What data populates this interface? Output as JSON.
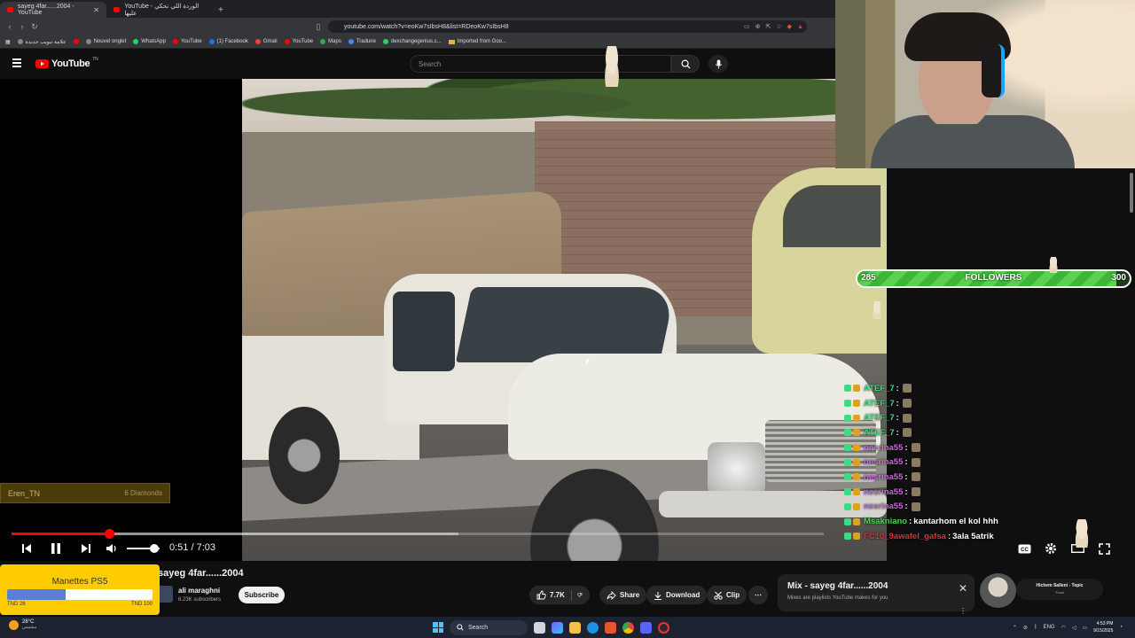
{
  "browser": {
    "tabs": [
      {
        "label": "sayeg 4far......2004 - YouTube",
        "active": true
      },
      {
        "label": "YouTube - الوردة اللي تحكي عليها",
        "active": false
      }
    ],
    "url": "youtube.com/watch?v=eoKw7sIbsH8&list=RDeoKw7sIbsH8",
    "bookmarks": [
      "علامة تبويب جديدة",
      "Nouvel onglet",
      "WhatsApp",
      "YouTube",
      "(1) Facebook",
      "Gmail",
      "YouTube",
      "Maps",
      "Traduire",
      "dexchangegenius.c...",
      "Imported from Goo..."
    ]
  },
  "youtube": {
    "logo_text": "YouTube",
    "logo_region": "TN",
    "search_placeholder": "Search",
    "player": {
      "current_time": "0:51",
      "duration": "7:03",
      "time_separator": "/",
      "played_fraction": 0.12,
      "buffered_fraction": 0.55,
      "volume_fraction": 0.85,
      "accent": "#ff0000"
    },
    "video": {
      "title": "sayeg 4far......2004",
      "channel": "ali maraghni",
      "subscribers": "6.23K subscribers",
      "subscribe_label": "Subscribe",
      "likes": "7.7K",
      "share_label": "Share",
      "download_label": "Download",
      "clip_label": "Clip"
    },
    "mix": {
      "title": "Mix - sayeg 4far......2004",
      "subtitle": "Mixes are playlists YouTube makes for you"
    },
    "related": {
      "name": "Hichem Salleni - Topic",
      "sub": "Trouli"
    }
  },
  "overlay": {
    "followers": {
      "current": "285",
      "label": "FOLLOWERS",
      "goal": "300",
      "fraction": 0.95
    },
    "chat": [
      {
        "user": "ATEF_7",
        "color": "#3ddc84",
        "sep": ":",
        "msg": ""
      },
      {
        "user": "ATEF_7",
        "color": "#3ddc84",
        "sep": ":",
        "msg": ""
      },
      {
        "user": "ATEF_7",
        "color": "#3ddc84",
        "sep": ":",
        "msg": ""
      },
      {
        "user": "ATEF_7",
        "color": "#3ddc84",
        "sep": ":",
        "msg": ""
      },
      {
        "user": "nesrina55",
        "color": "#c86bd6",
        "sep": ":",
        "msg": ""
      },
      {
        "user": "nesrina55",
        "color": "#c86bd6",
        "sep": ":",
        "msg": ""
      },
      {
        "user": "nesrina55",
        "color": "#c86bd6",
        "sep": ":",
        "msg": ""
      },
      {
        "user": "nesrina55",
        "color": "#c86bd6",
        "sep": ":",
        "msg": ""
      },
      {
        "user": "nesrina55",
        "color": "#c86bd6",
        "sep": ":",
        "msg": ""
      },
      {
        "user": "Msakniano",
        "color": "#4fd14f",
        "sep": ":",
        "msg": "kantarhom el kol hhh"
      },
      {
        "user": "FC10_9awafel_gafsa",
        "color": "#e0303a",
        "sep": ":",
        "msg": "3ala 5atrik"
      }
    ],
    "donation": {
      "user": "Eren_TN",
      "amount": "6 Diamonds"
    },
    "goal": {
      "title": "Manettes PS5",
      "min": "TND 26",
      "max": "TND 100",
      "fraction": 0.4,
      "accent": "#ffcc00"
    }
  },
  "taskbar": {
    "weather_temp": "28°C",
    "weather_desc": "مشمس",
    "search_label": "Search",
    "lang": "ENG",
    "time": "4:53 PM",
    "date": "9/15/2025"
  }
}
